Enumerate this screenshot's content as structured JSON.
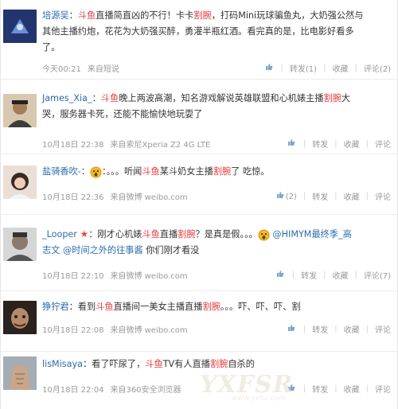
{
  "posts": [
    {
      "user": "培源吴",
      "text_lines": [
        [
          {
            "t": "：",
            "c": "n"
          },
          {
            "t": "斗鱼",
            "c": "h"
          },
          {
            "t": "直播简直凶的不行！卡卡",
            "c": "n"
          },
          {
            "t": "割腕",
            "c": "h"
          },
          {
            "t": "，打码Mini玩球骗鱼丸，大奶强公然与",
            "c": "n"
          }
        ],
        [
          {
            "t": "其他主播约炮，花花为大奶强买醉，勇灌半瓶红酒。看完真的是，比电影好看多",
            "c": "n"
          }
        ],
        [
          {
            "t": "了。",
            "c": "n"
          }
        ]
      ],
      "time": "今天00:21",
      "source": "来自短说",
      "likes": "",
      "repost_label": "转发(1)",
      "fav_label": "收藏",
      "comment_label": "评论(2)"
    },
    {
      "user": "James_Xia_",
      "text_lines": [
        [
          {
            "t": "：",
            "c": "n"
          },
          {
            "t": "斗鱼",
            "c": "h"
          },
          {
            "t": "晚上两波高潮，知名游戏解说英雄联盟和心机婊主播",
            "c": "n"
          },
          {
            "t": "割腕",
            "c": "h"
          },
          {
            "t": "大",
            "c": "n"
          }
        ],
        [
          {
            "t": "哭，服务器卡死，还能不能愉快地玩耍了",
            "c": "n"
          }
        ]
      ],
      "time": "10月18日 22:38",
      "source": "来自索尼Xperia Z2 4G LTE",
      "likes": "",
      "repost_label": "转发",
      "fav_label": "收藏",
      "comment_label": "评论"
    },
    {
      "user": "盐骑香吹-",
      "text_lines": [
        [
          {
            "t": "：",
            "c": "n"
          },
          {
            "t": "[emoji]",
            "c": "e"
          },
          {
            "t": "：。。。听闻",
            "c": "n"
          },
          {
            "t": "斗鱼",
            "c": "h"
          },
          {
            "t": "某斗奶女主播",
            "c": "n"
          },
          {
            "t": "割腕",
            "c": "h"
          },
          {
            "t": "了 吃惊。",
            "c": "n"
          }
        ]
      ],
      "time": "10月18日 22:36",
      "source": "来自微博 weibo.com",
      "likes": "(2)",
      "repost_label": "转发",
      "fav_label": "收藏",
      "comment_label": "评论"
    },
    {
      "user": "_Looper",
      "text_lines": [
        [
          {
            "t": "：刚才心机婊",
            "c": "n"
          },
          {
            "t": "斗鱼",
            "c": "h"
          },
          {
            "t": "直播",
            "c": "n"
          },
          {
            "t": "割腕",
            "c": "h"
          },
          {
            "t": "？是真是假。。。",
            "c": "n"
          },
          {
            "t": "[emoji]",
            "c": "e"
          },
          {
            "t": " @HIMYM最终季_高",
            "c": "a"
          }
        ],
        [
          {
            "t": "志文 ",
            "c": "a"
          },
          {
            "t": "@时间之外的往事酱",
            "c": "a"
          },
          {
            "t": " 你们刚才看没",
            "c": "n"
          }
        ]
      ],
      "time": "10月18日 22:10",
      "source": "来自微博 weibo.com",
      "likes": "",
      "repost_label": "转发",
      "fav_label": "收藏",
      "comment_label": "评论(7)"
    },
    {
      "user": "狰狞君",
      "text_lines": [
        [
          {
            "t": "：看到",
            "c": "n"
          },
          {
            "t": "斗鱼",
            "c": "h"
          },
          {
            "t": "直播间一美女主播直播",
            "c": "n"
          },
          {
            "t": "割腕",
            "c": "h"
          },
          {
            "t": "。。。吓、吓、吓、割",
            "c": "n"
          }
        ]
      ],
      "time": "10月18日 22:08",
      "source": "来自微博 weibo.com",
      "likes": "",
      "repost_label": "转发",
      "fav_label": "收藏",
      "comment_label": "评论"
    },
    {
      "user": "lisMisaya",
      "text_lines": [
        [
          {
            "t": "：看了吓尿了，",
            "c": "n"
          },
          {
            "t": "斗鱼",
            "c": "h"
          },
          {
            "t": "TV有人直播",
            "c": "n"
          },
          {
            "t": "割腕",
            "c": "h"
          },
          {
            "t": "自杀的",
            "c": "n"
          }
        ]
      ],
      "time": "10月18日 22:04",
      "source": "来自360安全浏览器",
      "likes": "",
      "repost_label": "转发",
      "fav_label": "收藏",
      "comment_label": "评论"
    }
  ],
  "watermark": {
    "big": "YXFSR",
    "small": "www.yxfsr.com"
  }
}
